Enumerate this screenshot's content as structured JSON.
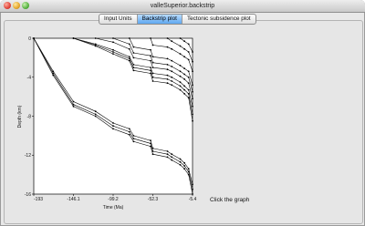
{
  "window": {
    "title": "valleSuperior.backstrip"
  },
  "tabs": [
    {
      "label": "Input Units",
      "active": false
    },
    {
      "label": "Backstrip plot",
      "active": true
    },
    {
      "label": "Tectonic subsidence plot",
      "active": false
    }
  ],
  "hint": "Click the graph",
  "chart_data": {
    "type": "line",
    "xlabel": "Time (Ma)",
    "ylabel": "Depth (km)",
    "xlim": [
      -193,
      -5.4
    ],
    "ylim": [
      -16,
      0
    ],
    "x_ticks": [
      "-193",
      "-146.1",
      "-99.2",
      "-52.3",
      "-5.4"
    ],
    "y_ticks": [
      "0",
      "-4",
      "-8",
      "-12",
      "-16"
    ],
    "grid": false,
    "series": [
      {
        "x": [
          -193,
          -170,
          -146.1,
          -120,
          -99.2,
          -80,
          -75,
          -55,
          -52.3,
          -35,
          -30,
          -20,
          -15,
          -10,
          -5.4
        ],
        "y": [
          0,
          -3.8,
          -7.0,
          -8.0,
          -9.3,
          -9.9,
          -10.6,
          -11.1,
          -11.9,
          -12.2,
          -12.5,
          -13.0,
          -13.4,
          -14.0,
          -16.0
        ]
      },
      {
        "x": [
          -193,
          -170,
          -146.1,
          -120,
          -99.2,
          -80,
          -75,
          -55,
          -52.3,
          -35,
          -30,
          -20,
          -15,
          -10,
          -5.4
        ],
        "y": [
          0,
          -3.6,
          -6.8,
          -7.8,
          -9.0,
          -9.6,
          -10.3,
          -10.8,
          -11.6,
          -11.9,
          -12.2,
          -12.7,
          -13.1,
          -13.7,
          -15.5
        ]
      },
      {
        "x": [
          -193,
          -170,
          -146.1,
          -120,
          -99.2,
          -80,
          -75,
          -55,
          -52.3,
          -35,
          -30,
          -20,
          -15,
          -10,
          -5.4
        ],
        "y": [
          0,
          -3.4,
          -6.5,
          -7.5,
          -8.7,
          -9.3,
          -10.0,
          -10.5,
          -11.3,
          -11.6,
          -11.9,
          -12.4,
          -12.8,
          -13.4,
          -15.0
        ]
      },
      {
        "x": [
          -146.1,
          -120,
          -99.2,
          -80,
          -75,
          -55,
          -52.3,
          -35,
          -30,
          -20,
          -15,
          -10,
          -5.4
        ],
        "y": [
          0,
          -0.8,
          -1.6,
          -2.3,
          -3.3,
          -3.6,
          -4.4,
          -4.6,
          -4.8,
          -5.3,
          -5.7,
          -6.1,
          -8.5
        ]
      },
      {
        "x": [
          -146.1,
          -120,
          -99.2,
          -80,
          -75,
          -55,
          -52.3,
          -35,
          -30,
          -20,
          -15,
          -10,
          -5.4
        ],
        "y": [
          0,
          -0.7,
          -1.4,
          -2.1,
          -3.0,
          -3.3,
          -4.0,
          -4.2,
          -4.4,
          -4.9,
          -5.3,
          -5.7,
          -7.8
        ]
      },
      {
        "x": [
          -146.1,
          -120,
          -99.2,
          -80,
          -75,
          -55,
          -52.3,
          -35,
          -30,
          -20,
          -15,
          -10,
          -5.4
        ],
        "y": [
          0,
          -0.6,
          -1.2,
          -1.9,
          -2.7,
          -3.0,
          -3.6,
          -3.8,
          -4.0,
          -4.5,
          -4.9,
          -5.3,
          -7.0
        ]
      },
      {
        "x": [
          -120,
          -99.2,
          -80,
          -75,
          -55,
          -52.3,
          -35,
          -30,
          -20,
          -15,
          -10,
          -5.4
        ],
        "y": [
          0,
          -0.4,
          -1.1,
          -2.0,
          -2.3,
          -3.0,
          -3.2,
          -3.4,
          -3.9,
          -4.2,
          -4.6,
          -6.2
        ]
      },
      {
        "x": [
          -99.2,
          -80,
          -75,
          -55,
          -52.3,
          -35,
          -30,
          -20,
          -15,
          -10,
          -5.4
        ],
        "y": [
          0,
          -0.6,
          -1.5,
          -1.8,
          -2.5,
          -2.7,
          -2.9,
          -3.4,
          -3.7,
          -4.0,
          -5.5
        ]
      },
      {
        "x": [
          -80,
          -75,
          -55,
          -52.3,
          -35,
          -30,
          -20,
          -15,
          -10,
          -5.4
        ],
        "y": [
          0,
          -0.9,
          -1.2,
          -1.9,
          -2.1,
          -2.3,
          -2.8,
          -3.1,
          -3.4,
          -4.8
        ]
      },
      {
        "x": [
          -55,
          -52.3,
          -35,
          -30,
          -20,
          -15,
          -10,
          -5.4
        ],
        "y": [
          0,
          -0.7,
          -0.9,
          -1.1,
          -1.6,
          -1.9,
          -2.2,
          -3.4
        ]
      },
      {
        "x": [
          -35,
          -30,
          -20,
          -15,
          -10,
          -5.4
        ],
        "y": [
          0,
          -0.3,
          -0.8,
          -1.1,
          -1.4,
          -2.4
        ]
      },
      {
        "x": [
          -20,
          -15,
          -10,
          -5.4
        ],
        "y": [
          0,
          -0.3,
          -0.6,
          -1.4
        ]
      }
    ]
  }
}
